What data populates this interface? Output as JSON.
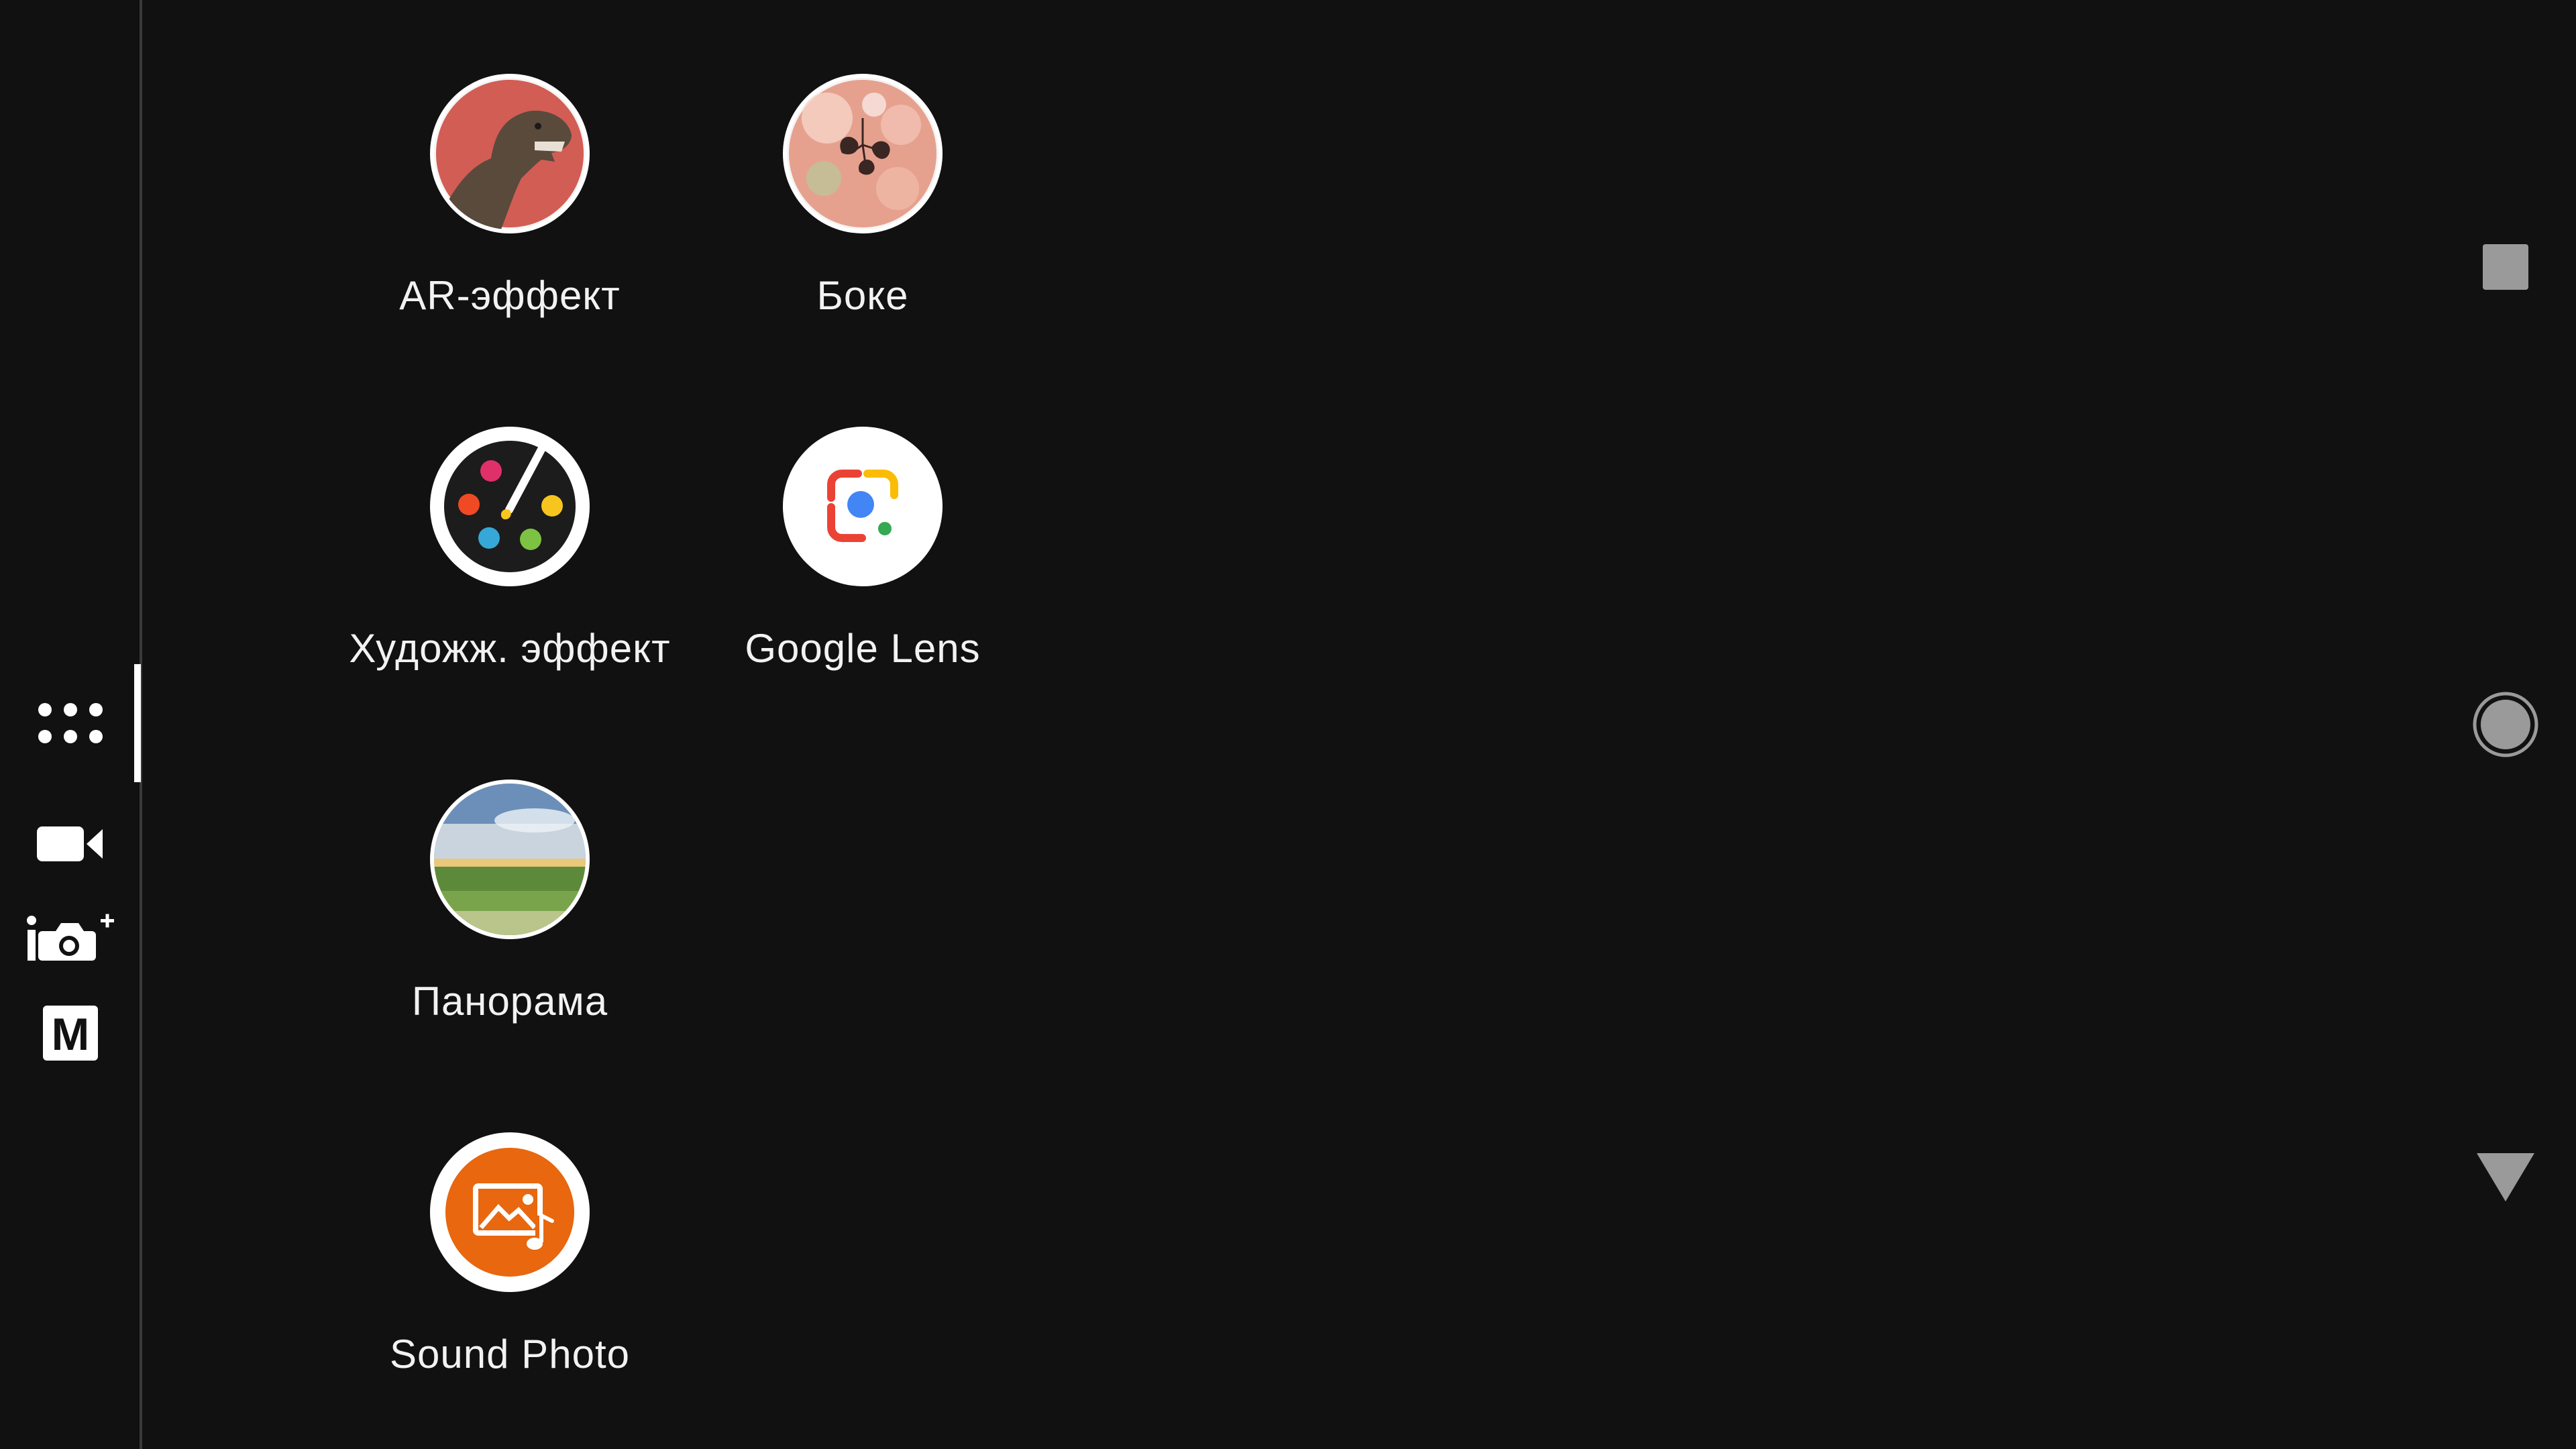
{
  "mode_rail": {
    "items": [
      {
        "name": "modes-grid",
        "icon": "apps-grid-icon",
        "active": true
      },
      {
        "name": "video",
        "icon": "video-camera-icon",
        "active": false
      },
      {
        "name": "intelligent-auto",
        "icon": "auto-camera-plus-icon",
        "active": false
      },
      {
        "name": "manual",
        "icon": "manual-mode-icon",
        "label": "M",
        "active": false
      }
    ]
  },
  "apps": [
    {
      "label": "AR-эффект",
      "icon": "ar-effect-dinosaur-icon"
    },
    {
      "label": "Боке",
      "icon": "bokeh-icon"
    },
    {
      "label": "Художж. эффект",
      "icon": "art-palette-icon"
    },
    {
      "label": "Google Lens",
      "icon": "google-lens-icon"
    },
    {
      "label": "Панорама",
      "icon": "panorama-landscape-icon"
    },
    {
      "label": "Sound Photo",
      "icon": "sound-photo-icon"
    }
  ],
  "right_controls": [
    {
      "name": "stop",
      "icon": "square-icon"
    },
    {
      "name": "shutter",
      "icon": "shutter-circle-icon"
    },
    {
      "name": "collapse",
      "icon": "triangle-down-icon"
    }
  ],
  "colors": {
    "background": "#111112",
    "rail_divider": "#3a3a3c",
    "label": "#f2f2f2",
    "control_gray": "#9a9a9a",
    "sound_photo_orange": "#e8670f"
  }
}
